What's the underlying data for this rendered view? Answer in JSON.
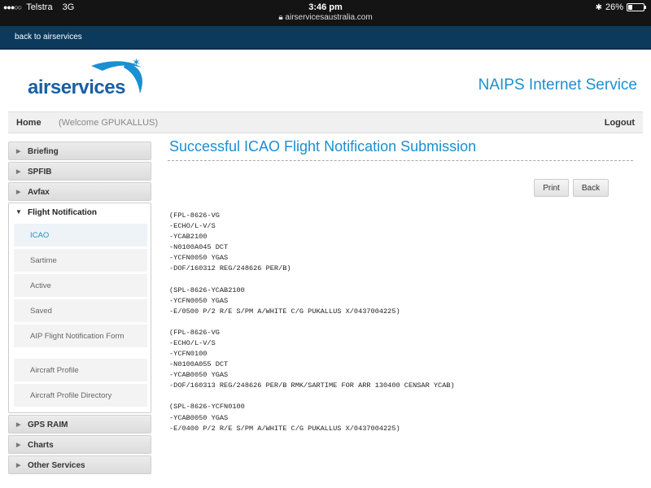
{
  "status_bar": {
    "carrier": "Telstra",
    "network": "3G",
    "time": "3:46 pm",
    "url": "airservicesaustralia.com",
    "battery": "26%",
    "battery_level": 0.26
  },
  "top_link": "back to airservices",
  "header": {
    "logo_text": "airservices",
    "service_title": "NAIPS Internet Service"
  },
  "navbar": {
    "home": "Home",
    "welcome": "(Welcome GPUKALLUS)",
    "logout": "Logout"
  },
  "sidebar": {
    "top_items": [
      {
        "label": "Briefing"
      },
      {
        "label": "SPFIB"
      },
      {
        "label": "Avfax"
      }
    ],
    "open_section": {
      "label": "Flight Notification",
      "items": [
        {
          "label": "ICAO",
          "active": true
        },
        {
          "label": "Sartime"
        },
        {
          "label": "Active"
        },
        {
          "label": "Saved"
        },
        {
          "label": "AIP Flight Notification Form"
        },
        {
          "label": "Aircraft Profile"
        },
        {
          "label": "Aircraft Profile Directory"
        }
      ]
    },
    "bottom_items": [
      {
        "label": "GPS RAIM"
      },
      {
        "label": "Charts"
      },
      {
        "label": "Other Services"
      }
    ]
  },
  "main": {
    "title": "Successful ICAO Flight Notification Submission",
    "print_label": "Print",
    "back_label": "Back",
    "messages": [
      [
        "(FPL-8626-VG",
        "-ECHO/L-V/S",
        "-YCAB2100",
        "-N0100A045 DCT",
        "-YCFN0050 YGAS",
        "-DOF/160312 REG/248626 PER/B)"
      ],
      [
        "(SPL-8626-YCAB2100",
        "-YCFN0050 YGAS",
        "-E/0500 P/2 R/E S/PM A/WHITE C/G PUKALLUS X/0437004225)"
      ],
      [
        "(FPL-8626-VG",
        "-ECHO/L-V/S",
        "-YCFN0100",
        "-N0100A055 DCT",
        "-YCAB0050 YGAS",
        "-DOF/160313 REG/248626 PER/B RMK/SARTIME FOR ARR 130400 CENSAR YCAB)"
      ],
      [
        "(SPL-8626-YCFN0100",
        "-YCAB0050 YGAS",
        "-E/0400 P/2 R/E S/PM A/WHITE C/G PUKALLUS X/0437004225)"
      ]
    ]
  },
  "colors": {
    "accent": "#1a8fd1",
    "top_strip": "#0b3a5c",
    "logo_blue": "#1a5fa5"
  }
}
